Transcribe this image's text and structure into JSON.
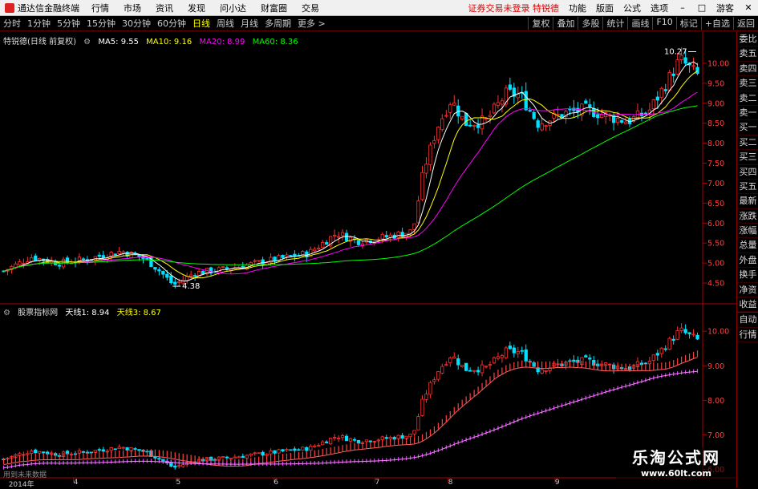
{
  "topbar": {
    "app_title": "通达信金融终端",
    "menus": [
      "行情",
      "市场",
      "资讯",
      "发现",
      "问小达",
      "财富圈",
      "交易"
    ],
    "alert": "证券交易未登录  特锐德",
    "right_menus": [
      "功能",
      "版面",
      "公式",
      "选项"
    ],
    "guest": "游客"
  },
  "toolbar": {
    "timeframes": [
      "分时",
      "1分钟",
      "5分钟",
      "15分钟",
      "30分钟",
      "60分钟",
      "日线",
      "周线",
      "月线",
      "多周期",
      "更多 >"
    ],
    "active_timeframe": "日线",
    "right_buttons": [
      "复权",
      "叠加",
      "多股",
      "统计",
      "画线",
      "F10",
      "标记",
      "+自选",
      "返回"
    ]
  },
  "right_panel": {
    "items": [
      "委比",
      "卖五",
      "卖四",
      "卖三",
      "卖二",
      "卖一",
      "买一",
      "买二",
      "买三",
      "买四",
      "买五",
      "最新",
      "涨跌",
      "涨幅",
      "总量",
      "外盘",
      "换手",
      "净资",
      "收益",
      "自动",
      "行情"
    ]
  },
  "legend": {
    "stock_label": "特锐德(日线 前复权)",
    "ma5": "MA5: 9.55",
    "ma10": "MA10: 9.16",
    "ma20": "MA20: 8.99",
    "ma60": "MA60: 8.36",
    "indicator_name": "股票指标网",
    "line1": "天线1: 8.94",
    "line3": "天线3: 8.67"
  },
  "chart_data": {
    "type": "candlestick",
    "main_axis": {
      "ylim": [
        4.1,
        10.5
      ],
      "ticks": [
        4.5,
        5.0,
        5.5,
        6.0,
        6.5,
        7.0,
        7.5,
        8.0,
        8.5,
        9.0,
        9.5,
        10.0
      ]
    },
    "indicator_axis": {
      "ylim": [
        5.8,
        10.4
      ],
      "ticks": [
        6.0,
        7.0,
        8.0,
        9.0,
        10.0
      ]
    },
    "high_label": "10.27",
    "low_label": "4.38",
    "x_axis_labels": [
      {
        "label": "2014年",
        "pos": 0.01
      },
      {
        "label": "4",
        "pos": 0.103
      },
      {
        "label": "5",
        "pos": 0.25
      },
      {
        "label": "6",
        "pos": 0.39
      },
      {
        "label": "7",
        "pos": 0.535
      },
      {
        "label": "8",
        "pos": 0.64
      },
      {
        "label": "9",
        "pos": 0.793
      }
    ],
    "key_prices": [
      {
        "pos": 0.0,
        "price": 4.8
      },
      {
        "pos": 0.04,
        "price": 5.15
      },
      {
        "pos": 0.08,
        "price": 5.0
      },
      {
        "pos": 0.12,
        "price": 5.1
      },
      {
        "pos": 0.17,
        "price": 5.3
      },
      {
        "pos": 0.205,
        "price": 5.1
      },
      {
        "pos": 0.225,
        "price": 4.8
      },
      {
        "pos": 0.245,
        "price": 4.45
      },
      {
        "pos": 0.275,
        "price": 4.75
      },
      {
        "pos": 0.32,
        "price": 4.85
      },
      {
        "pos": 0.38,
        "price": 5.05
      },
      {
        "pos": 0.44,
        "price": 5.25
      },
      {
        "pos": 0.48,
        "price": 5.75
      },
      {
        "pos": 0.51,
        "price": 5.55
      },
      {
        "pos": 0.55,
        "price": 5.65
      },
      {
        "pos": 0.59,
        "price": 5.8
      },
      {
        "pos": 0.605,
        "price": 7.3
      },
      {
        "pos": 0.625,
        "price": 8.4
      },
      {
        "pos": 0.645,
        "price": 9.1
      },
      {
        "pos": 0.665,
        "price": 8.5
      },
      {
        "pos": 0.695,
        "price": 8.55
      },
      {
        "pos": 0.725,
        "price": 9.25
      },
      {
        "pos": 0.745,
        "price": 9.2
      },
      {
        "pos": 0.77,
        "price": 8.5
      },
      {
        "pos": 0.81,
        "price": 8.75
      },
      {
        "pos": 0.84,
        "price": 8.85
      },
      {
        "pos": 0.875,
        "price": 8.65
      },
      {
        "pos": 0.9,
        "price": 8.55
      },
      {
        "pos": 0.93,
        "price": 8.8
      },
      {
        "pos": 0.955,
        "price": 9.5
      },
      {
        "pos": 0.975,
        "price": 10.1
      },
      {
        "pos": 1.0,
        "price": 9.7
      }
    ]
  },
  "watermark": {
    "line1": "乐淘公式网",
    "line2": "www.60lt.com"
  },
  "notice": "用到未来数据",
  "colors": {
    "up": "#ff3030",
    "down": "#00e0ff",
    "ma5": "#ffffff",
    "ma10": "#ffff00",
    "ma20": "#ff00ff",
    "ma60": "#00ff00",
    "axis": "#b00000"
  }
}
